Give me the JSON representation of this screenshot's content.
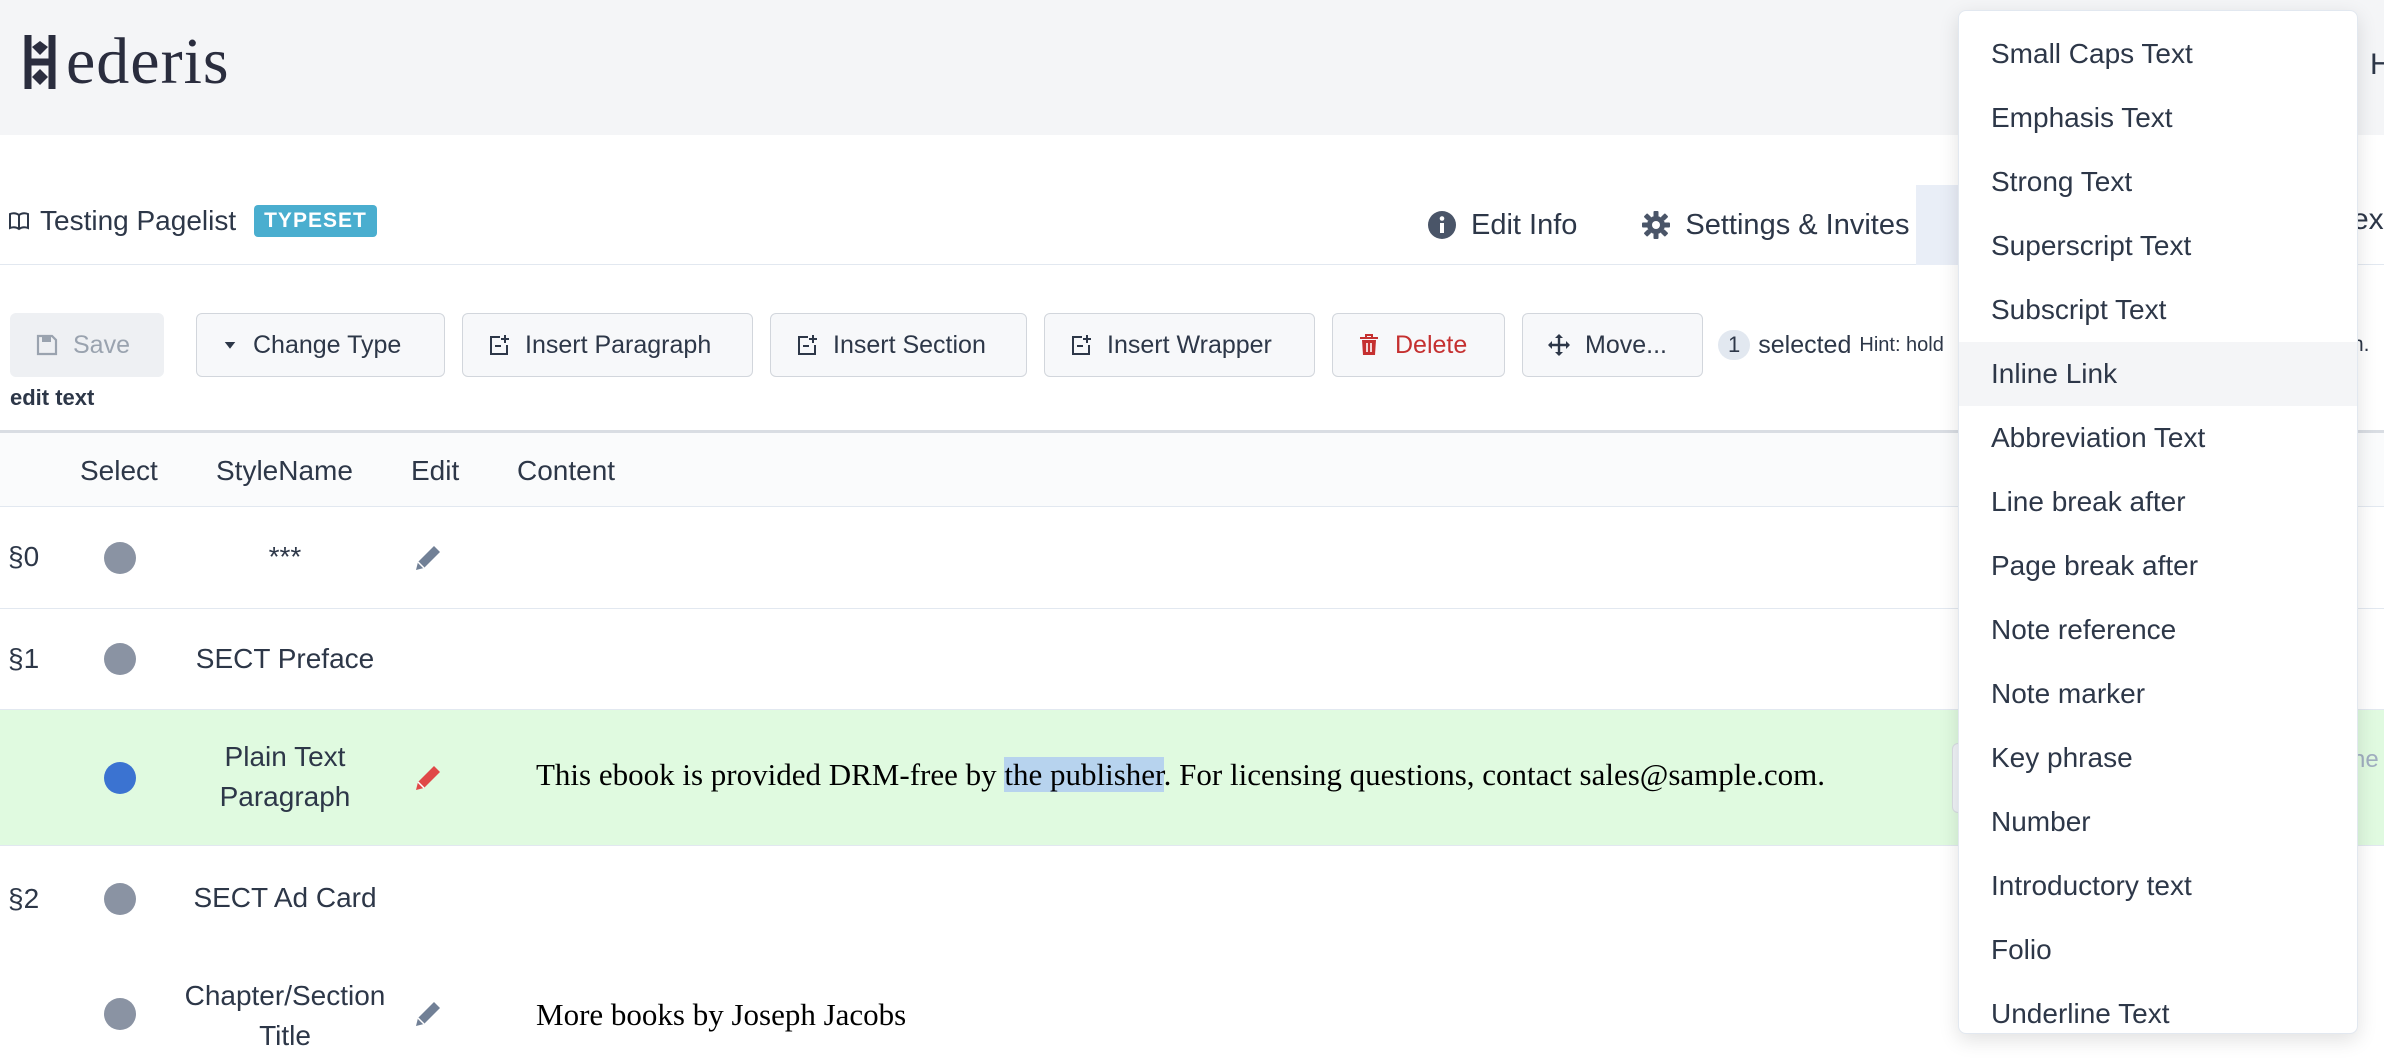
{
  "app": {
    "logo_text": "ederis",
    "header_right_text": "H"
  },
  "document": {
    "title": "Testing Pagelist",
    "badge": "TYPESET",
    "tabs": [
      {
        "label": "Edit Info",
        "icon": "info-icon"
      },
      {
        "label": "Settings & Invites",
        "icon": "gear-icon"
      }
    ],
    "active_tab_edge_text": "ex"
  },
  "toolbar": {
    "save_label": "Save",
    "change_type_label": "Change Type",
    "insert_paragraph_label": "Insert Paragraph",
    "insert_section_label": "Insert Section",
    "insert_wrapper_label": "Insert Wrapper",
    "delete_label": "Delete",
    "move_label": "Move...",
    "selected_count": "1",
    "selected_label": "selected",
    "hint": "Hint: hold",
    "hint_tail": "n.",
    "edit_text_label": "edit text"
  },
  "table": {
    "headers": {
      "select": "Select",
      "style": "StyleName",
      "edit": "Edit",
      "content": "Content"
    },
    "rows": [
      {
        "num": "§0",
        "style": "***",
        "content": ""
      },
      {
        "num": "§1",
        "style": "SECT Preface",
        "content": ""
      },
      {
        "num": "",
        "style": "Plain Text Paragraph",
        "content_before": "This ebook is provided DRM-free by ",
        "content_selected": "the publisher",
        "content_after": ". For licensing questions, contact sales@sample.com.",
        "right_text": "he"
      },
      {
        "num": "§2",
        "style": "SECT Ad Card",
        "content": ""
      },
      {
        "num": "",
        "style": "Chapter/Section Title",
        "content": "More books by Joseph Jacobs"
      }
    ]
  },
  "dropdown": {
    "items": [
      "Small Caps Text",
      "Emphasis Text",
      "Strong Text",
      "Superscript Text",
      "Subscript Text",
      "Inline Link",
      "Abbreviation Text",
      "Line break after",
      "Page break after",
      "Note reference",
      "Note marker",
      "Key phrase",
      "Number",
      "Introductory text",
      "Folio",
      "Underline Text"
    ],
    "hovered_index": 5
  },
  "colors": {
    "badge": "#4aaecf",
    "highlight_row": "#e0fae0",
    "selection": "#b7d3ee",
    "selected_dot": "#3b73d1",
    "delete": "#c53030"
  }
}
